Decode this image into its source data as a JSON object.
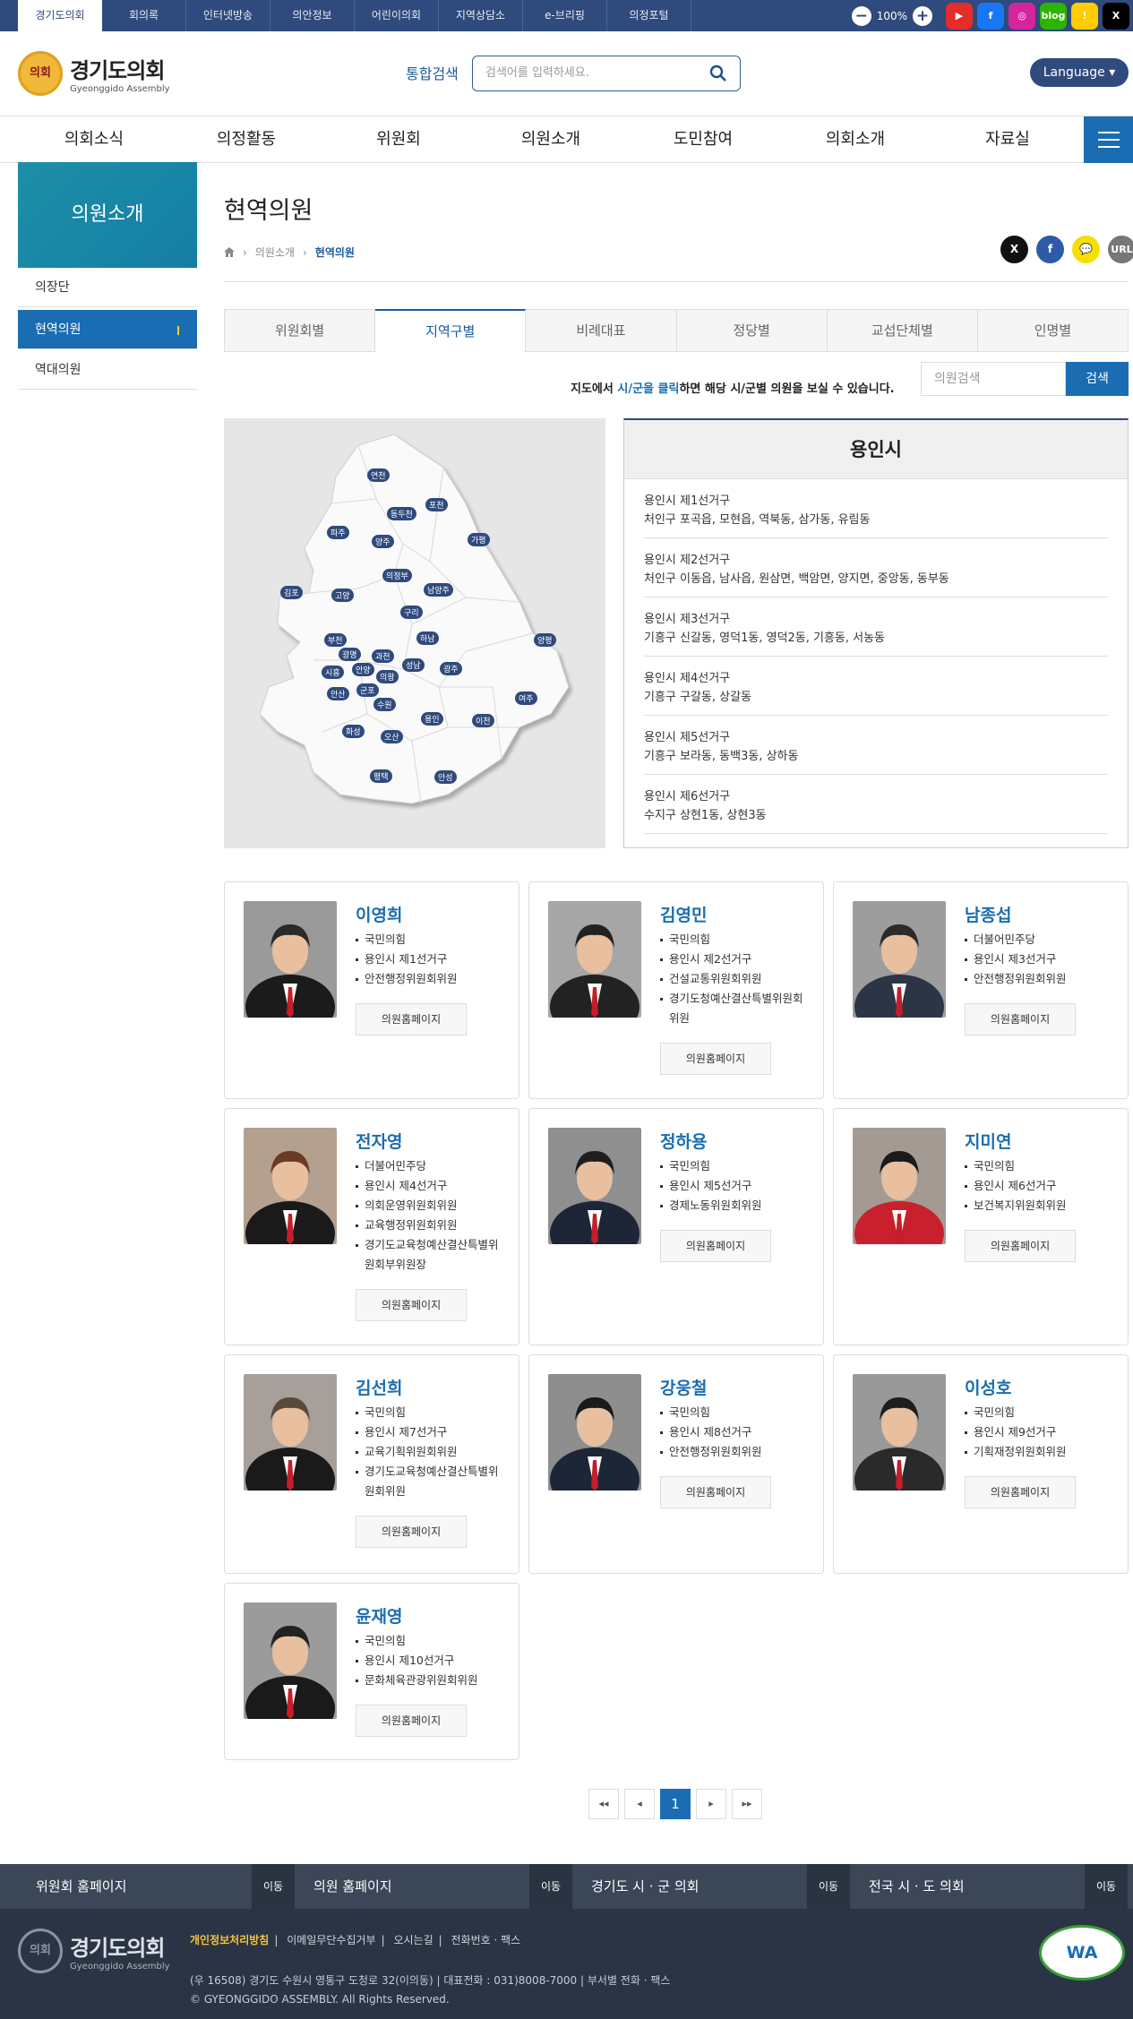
{
  "topbar": {
    "tabs": [
      "경기도의회",
      "회의록",
      "인터넷방송",
      "의안정보",
      "어린이의회",
      "지역상담소",
      "e-브리핑",
      "의정포털"
    ],
    "zoom": "100%",
    "zoom_out": "−",
    "zoom_in": "+",
    "social": [
      {
        "icon": "youtube-icon",
        "color": "#e52d27",
        "label": "▶"
      },
      {
        "icon": "facebook-icon",
        "color": "#1877f2",
        "label": "f"
      },
      {
        "icon": "instagram-icon",
        "color": "#d6249f",
        "label": "◎"
      },
      {
        "icon": "blog-icon",
        "color": "#2db400",
        "label": "blog"
      },
      {
        "icon": "kakao-story-icon",
        "color": "#ffcd00",
        "label": "!"
      },
      {
        "icon": "x-icon",
        "color": "#000000",
        "label": "X"
      }
    ]
  },
  "header": {
    "logo_ko": "경기도의회",
    "logo_en": "Gyeonggido Assembly",
    "seal_text": "의회",
    "search_label": "통합검색",
    "search_placeholder": "검색어를 입력하세요.",
    "language": "Language ▾"
  },
  "gnb": [
    "의회소식",
    "의정활동",
    "위원회",
    "의원소개",
    "도민참여",
    "의회소개",
    "자료실"
  ],
  "lnb": {
    "title": "의원소개",
    "items": [
      "의장단",
      "현역의원",
      "역대의원"
    ]
  },
  "page": {
    "title": "현역의원",
    "breadcrumb": [
      "의원소개",
      "현역의원"
    ],
    "share": [
      "X",
      "f",
      "💬",
      "URL"
    ]
  },
  "subtabs": [
    "위원회별",
    "지역구별",
    "비례대표",
    "정당별",
    "교섭단체별",
    "인명별"
  ],
  "map_guide": {
    "prefix": "지도에서 ",
    "highlight": "시/군을 클릭",
    "suffix": "하면 해당 시/군별 의원을 보실 수 있습니다."
  },
  "member_search": {
    "placeholder": "의원검색",
    "button": "검색"
  },
  "map_labels": [
    "연천",
    "포천",
    "동두천",
    "파주",
    "양주",
    "가평",
    "의정부",
    "김포",
    "고양",
    "남양주",
    "구리",
    "양평",
    "하남",
    "부천",
    "광명",
    "과천",
    "시흥",
    "안양",
    "의왕",
    "성남",
    "광주",
    "안산",
    "군포",
    "수원",
    "여주",
    "용인",
    "이천",
    "화성",
    "오산",
    "평택",
    "안성"
  ],
  "district": {
    "title": "용인시",
    "items": [
      {
        "name": "용인시 제1선거구",
        "areas": "처인구 포곡읍, 모현읍, 역북동, 삼가동, 유림동"
      },
      {
        "name": "용인시 제2선거구",
        "areas": "처인구 이동읍, 남사읍, 원삼면, 백암면, 양지면, 중앙동, 동부동"
      },
      {
        "name": "용인시 제3선거구",
        "areas": "기흥구 신갈동, 영덕1동, 영덕2동, 기흥동, 서농동"
      },
      {
        "name": "용인시 제4선거구",
        "areas": "기흥구 구갈동, 상갈동"
      },
      {
        "name": "용인시 제5선거구",
        "areas": "기흥구 보라동, 동백3동, 상하동"
      },
      {
        "name": "용인시 제6선거구",
        "areas": "수지구 상현1동, 상현3동"
      }
    ]
  },
  "members": [
    {
      "name": "이영희",
      "party": "국민의힘",
      "district": "용인시 제1선거구",
      "roles": [
        "안전행정위원회위원"
      ]
    },
    {
      "name": "김영민",
      "party": "국민의힘",
      "district": "용인시 제2선거구",
      "roles": [
        "건설교통위원회위원",
        "경기도청예산결산특별위원회위원"
      ]
    },
    {
      "name": "남종섭",
      "party": "더불어민주당",
      "district": "용인시 제3선거구",
      "roles": [
        "안전행정위원회위원"
      ]
    },
    {
      "name": "전자영",
      "party": "더불어민주당",
      "district": "용인시 제4선거구",
      "roles": [
        "의회운영위원회위원",
        "교육행정위원회위원",
        "경기도교육청예산결산특별위원회부위원장"
      ]
    },
    {
      "name": "정하용",
      "party": "국민의힘",
      "district": "용인시 제5선거구",
      "roles": [
        "경제노동위원회위원"
      ]
    },
    {
      "name": "지미연",
      "party": "국민의힘",
      "district": "용인시 제6선거구",
      "roles": [
        "보건복지위원회위원"
      ]
    },
    {
      "name": "김선희",
      "party": "국민의힘",
      "district": "용인시 제7선거구",
      "roles": [
        "교육기획위원회위원",
        "경기도교육청예산결산특별위원회위원"
      ]
    },
    {
      "name": "강웅철",
      "party": "국민의힘",
      "district": "용인시 제8선거구",
      "roles": [
        "안전행정위원회위원"
      ]
    },
    {
      "name": "이성호",
      "party": "국민의힘",
      "district": "용인시 제9선거구",
      "roles": [
        "기획재정위원회위원"
      ]
    },
    {
      "name": "윤재영",
      "party": "국민의힘",
      "district": "용인시 제10선거구",
      "roles": [
        "문화체육관광위원회위원"
      ]
    }
  ],
  "homepage_label": "의원홈페이지",
  "pager": {
    "first": "◂◂",
    "prev": "◂",
    "current": "1",
    "next": "▸",
    "last": "▸▸"
  },
  "footer_links": [
    {
      "label": "위원회 홈페이지",
      "btn": "이동"
    },
    {
      "label": "의원 홈페이지",
      "btn": "이동"
    },
    {
      "label": "경기도 시 · 군 의회",
      "btn": "이동"
    },
    {
      "label": "전국 시 · 도 의회",
      "btn": "이동"
    }
  ],
  "footer": {
    "menu": [
      "개인정보처리방침",
      "이메일무단수집거부",
      "오시는길",
      "전화번호 · 팩스"
    ],
    "address": "(우 16508) 경기도 수원시 영통구 도청로 32(이의동) | 대표전화 : 031)8008-7000 | 부서별 전화 · 팩스",
    "copyright": "© GYEONGGIDO ASSEMBLY. All Rights Reserved.",
    "wa_mark": "WA"
  }
}
